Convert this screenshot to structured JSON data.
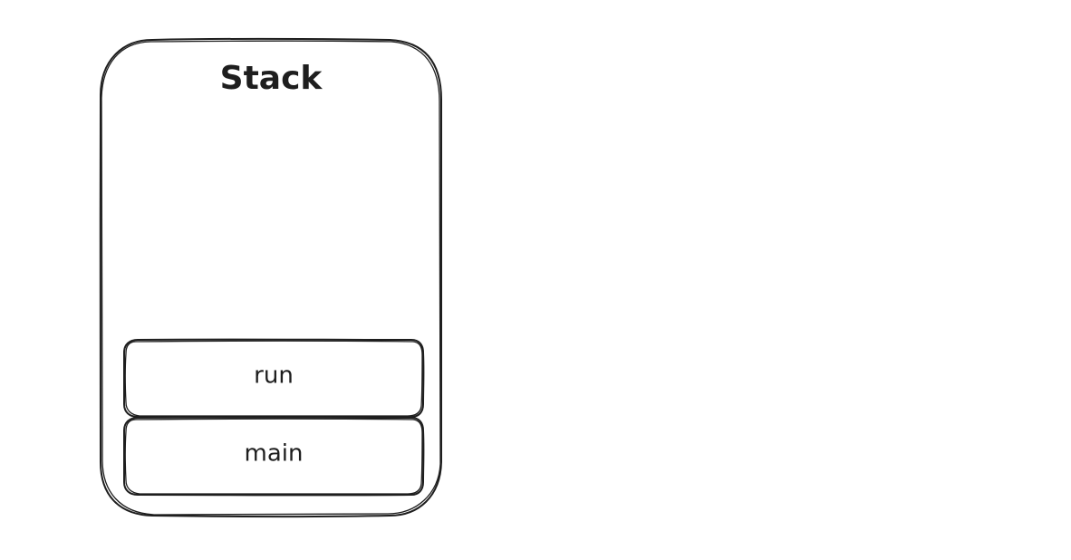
{
  "diagram": {
    "stack": {
      "title": "Stack",
      "frames": [
        {
          "label": "run"
        },
        {
          "label": "main"
        }
      ]
    }
  }
}
